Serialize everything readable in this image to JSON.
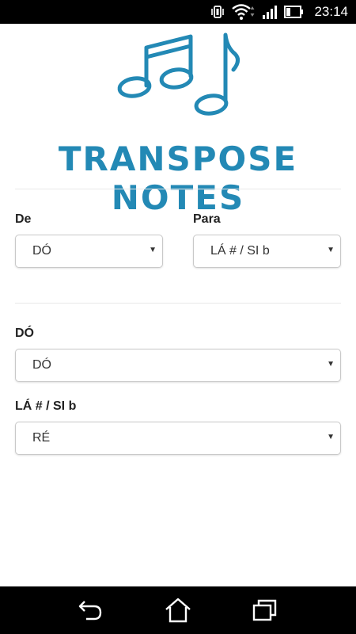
{
  "status_bar": {
    "time": "23:14",
    "icons": [
      "vibrate-icon",
      "wifi-icon",
      "signal-icon",
      "battery-icon"
    ]
  },
  "app": {
    "title": "TRANSPOSE NOTES",
    "logo": "music-notes-icon",
    "accent_color": "#2389b5"
  },
  "transpose": {
    "from_label": "De",
    "from_value": "DÓ",
    "to_label": "Para",
    "to_value": "LÁ # / SI b"
  },
  "notes": {
    "source_label": "DÓ",
    "source_value": "DÓ",
    "target_label": "LÁ # / SI b",
    "target_value": "RÉ"
  },
  "nav_bar": {
    "buttons": [
      "back-icon",
      "home-icon",
      "recent-apps-icon"
    ]
  }
}
